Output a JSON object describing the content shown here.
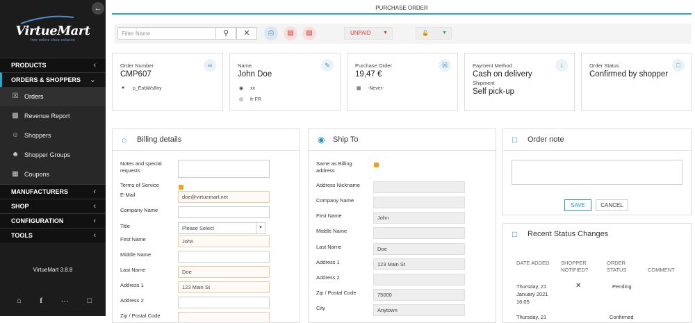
{
  "sidebar": {
    "logo": {
      "main": "VirtueMart",
      "tagline": "free online shop solution"
    },
    "menu": [
      {
        "label": "PRODUCTS",
        "type": "header"
      },
      {
        "label": "ORDERS & SHOPPERS",
        "type": "header",
        "open": true
      },
      {
        "label": "Orders",
        "icon": "cart-icon",
        "type": "item",
        "active": true
      },
      {
        "label": "Revenue Report",
        "icon": "chart-icon",
        "type": "item"
      },
      {
        "label": "Shoppers",
        "icon": "user-icon",
        "type": "item"
      },
      {
        "label": "Shopper Groups",
        "icon": "users-icon",
        "type": "item"
      },
      {
        "label": "Coupons",
        "icon": "gift-icon",
        "type": "item"
      },
      {
        "label": "MANUFACTURERS",
        "type": "header"
      },
      {
        "label": "SHOP",
        "type": "header"
      },
      {
        "label": "CONFIGURATION",
        "type": "header"
      },
      {
        "label": "TOOLS",
        "type": "header"
      }
    ],
    "version": "VirtueMart 3.8.8"
  },
  "page_title": "PURCHASE ORDER",
  "toolbar": {
    "filter_placeholder": "Filter Name",
    "status_label": "UNPAID",
    "status_color": "#e0342a"
  },
  "cards": {
    "order_number": {
      "label": "Order Number",
      "value": "CMP607",
      "pass": "p_EobWs8ny"
    },
    "name": {
      "label": "Name",
      "value": "John Doe",
      "location": "xx",
      "language": "fr-FR"
    },
    "purchase_order": {
      "label": "Purchase Order",
      "value": "19,47 €",
      "date": "-Never-"
    },
    "payment": {
      "label": "Payment Method",
      "value": "Cash on delivery",
      "shipment_label": "Shipment",
      "shipment_value": "Self pick-up"
    },
    "status": {
      "label": "Order Status",
      "value": "Confirmed by shopper"
    }
  },
  "billing": {
    "title": "Billing details",
    "notes_label": "Notes and special requests",
    "tos_label": "Terms of Service",
    "email_label": "E-Mail",
    "email_value": "doe@virtuemart.net",
    "company_label": "Company Name",
    "title_label": "Title",
    "title_value": "Please Select",
    "first_label": "First Name",
    "first_value": "John",
    "middle_label": "Middle Name",
    "last_label": "Last Name",
    "last_value": "Doe",
    "addr1_label": "Address 1",
    "addr1_value": "123 Main St",
    "addr2_label": "Address 2",
    "zip_label": "Zip / Postal Code"
  },
  "shipto": {
    "title": "Ship To",
    "same_label": "Same as Billing address",
    "nickname_label": "Address Nickname",
    "company_label": "Company Name",
    "first_label": "First Name",
    "first_value": "John",
    "middle_label": "Middle Name",
    "last_label": "Last Name",
    "last_value": "Doe",
    "addr1_label": "Address 1",
    "addr1_value": "123 Main St",
    "addr2_label": "Address 2",
    "zip_label": "Zip / Postal Code",
    "zip_value": "75000",
    "city_label": "City",
    "city_value": "Anytown"
  },
  "order_note": {
    "title": "Order note",
    "save": "SAVE",
    "cancel": "CANCEL"
  },
  "status_changes": {
    "title": "Recent Status Changes",
    "headers": {
      "date": "DATE ADDED",
      "notified": "SHOPPER NOTIFIED?",
      "status": "ORDER STATUS",
      "comment": "COMMENT"
    },
    "rows": [
      {
        "date": "Thursday, 21 January 2021 16:05",
        "status": "Pending"
      },
      {
        "date": "Thursday, 21",
        "status": "Confirmed"
      }
    ]
  }
}
